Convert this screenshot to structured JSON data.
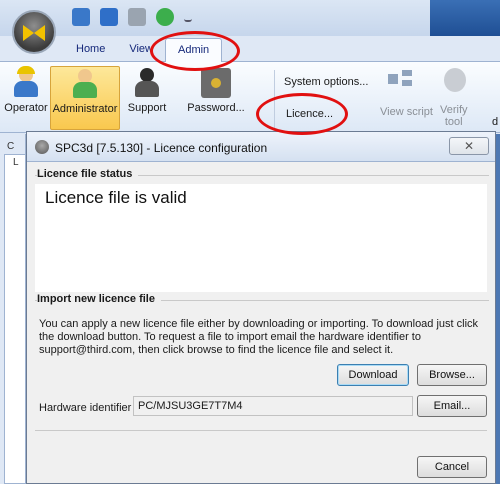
{
  "quick_access": {
    "icons": [
      "new-file-icon",
      "open-file-icon",
      "print-icon",
      "refresh-icon",
      "customize-qat-icon"
    ]
  },
  "tabs": [
    {
      "label": "Home"
    },
    {
      "label": "View"
    },
    {
      "label": "Admin"
    }
  ],
  "ribbon": {
    "operator_label": "Operator",
    "administrator_label": "Administrator",
    "support_label": "Support",
    "password_label": "Password...",
    "system_options_label": "System options...",
    "licence_label": "Licence...",
    "view_script_label": "View script",
    "verify_tool_label_1": "Verify",
    "verify_tool_label_2": "tool",
    "cut_letter": "d"
  },
  "dialog": {
    "title": "SPC3d [7.5.130] - Licence configuration",
    "close_glyph": "✕",
    "status_group_label": "Licence file status",
    "status_text": "Licence file is valid",
    "import_group_label": "Import new licence file",
    "description": "You can apply a new licence file either by downloading or importing. To download just click the download button. To request a file to import email the hardware identifier to support@third.com, then click browse to find the licence file and select it.",
    "download_label": "Download",
    "browse_label": "Browse...",
    "hw_label": "Hardware identifier",
    "hw_value": "PC/MJSU3GE7T7M4",
    "email_label": "Email...",
    "cancel_label": "Cancel"
  },
  "background": {
    "left_letter_c": "C",
    "left_letter_l": "L"
  },
  "colors": {
    "highlight": "#e11010",
    "accent": "#3a6fb5",
    "selected_ribbon": "#f9c84e"
  }
}
